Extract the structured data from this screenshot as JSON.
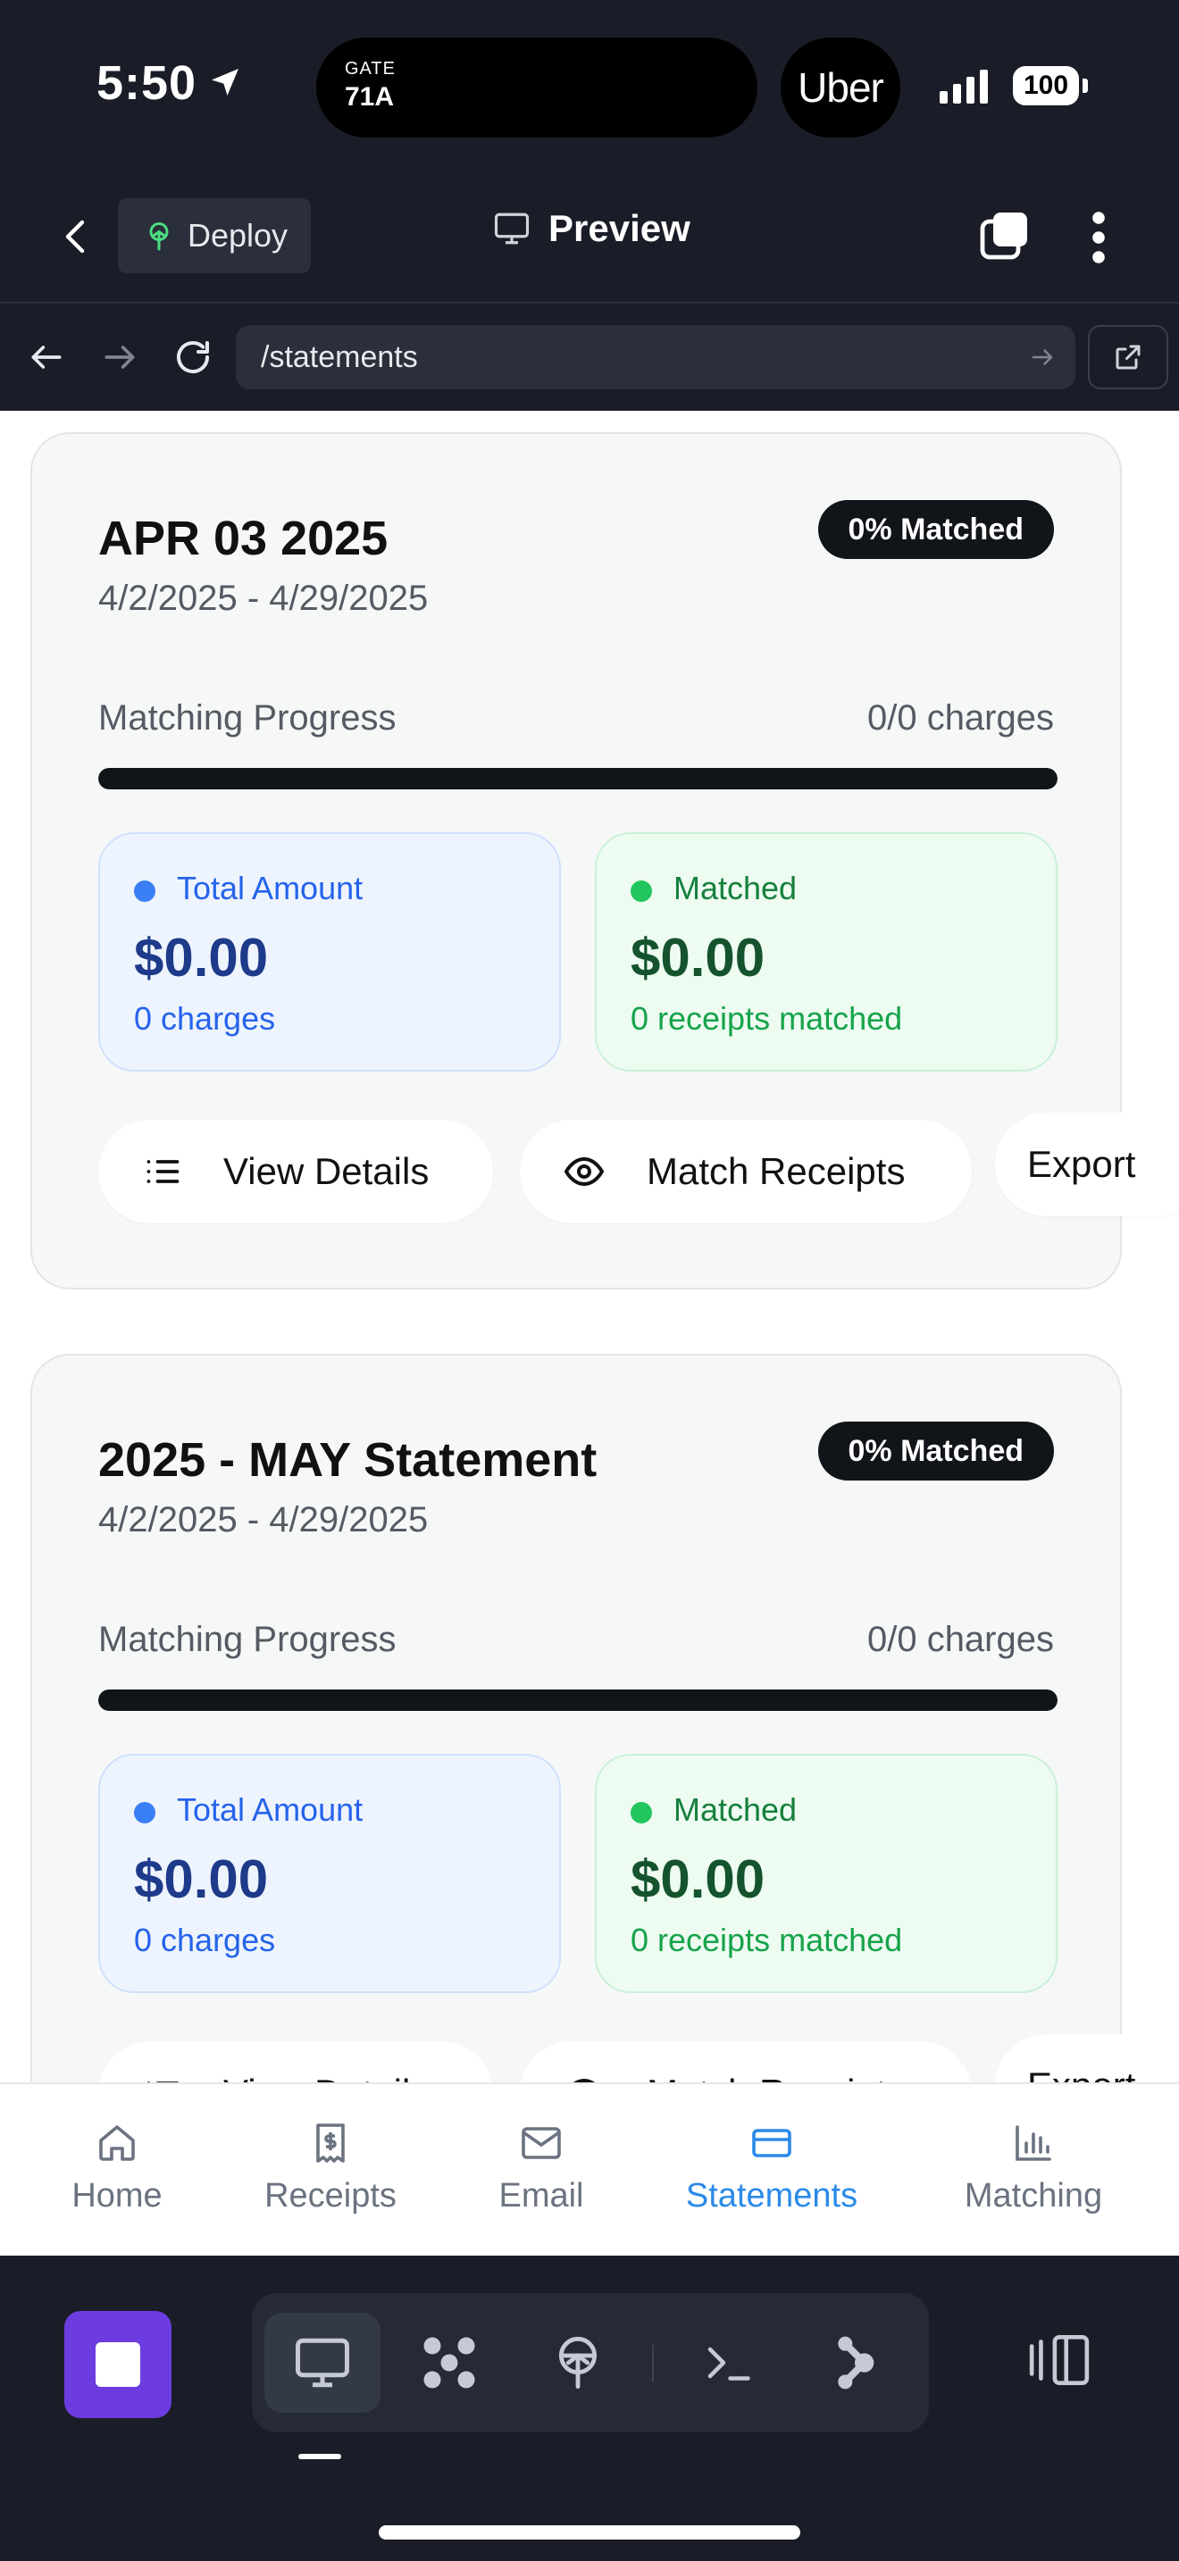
{
  "status_bar": {
    "time": "5:50",
    "activity_label": "GATE",
    "activity_value": "71A",
    "app_pill": "Uber",
    "battery": "100"
  },
  "header": {
    "deploy_label": "Deploy",
    "preview_label": "Preview"
  },
  "url_bar": {
    "url": "/statements"
  },
  "statements": [
    {
      "title": "APR 03 2025",
      "dates": "4/2/2025 - 4/29/2025",
      "badge": "0% Matched",
      "progress_label": "Matching Progress",
      "progress_count": "0/0 charges",
      "progress_fraction": 1.0,
      "total_label": "Total Amount",
      "total_amount": "$0.00",
      "total_sub": "0 charges",
      "matched_label": "Matched",
      "matched_amount": "$0.00",
      "matched_sub": "0 receipts matched",
      "btn_details": "View Details",
      "btn_match": "Match Receipts",
      "btn_export": "Export"
    },
    {
      "title": "2025 - MAY Statement",
      "dates": "4/2/2025 - 4/29/2025",
      "badge": "0% Matched",
      "progress_label": "Matching Progress",
      "progress_count": "0/0 charges",
      "progress_fraction": 1.0,
      "total_label": "Total Amount",
      "total_amount": "$0.00",
      "total_sub": "0 charges",
      "matched_label": "Matched",
      "matched_amount": "$0.00",
      "matched_sub": "0 receipts matched",
      "btn_details": "View Details",
      "btn_match": "Match Receipts",
      "btn_export": "Export"
    }
  ],
  "bottom_nav": {
    "items": [
      {
        "label": "Home",
        "icon": "home-icon"
      },
      {
        "label": "Receipts",
        "icon": "receipt-icon"
      },
      {
        "label": "Email",
        "icon": "mail-icon"
      },
      {
        "label": "Statements",
        "icon": "credit-card-icon"
      },
      {
        "label": "Matching",
        "icon": "bar-chart-icon"
      }
    ],
    "active": "Statements"
  },
  "toolbar": {
    "tools": [
      "desktop-icon",
      "components-icon",
      "deploy-icon",
      "terminal-icon",
      "integrations-icon"
    ]
  },
  "colors": {
    "accent_blue": "#2b8ae8",
    "stop_purple": "#6c3ce0",
    "dark_bg": "#1a1d27"
  }
}
